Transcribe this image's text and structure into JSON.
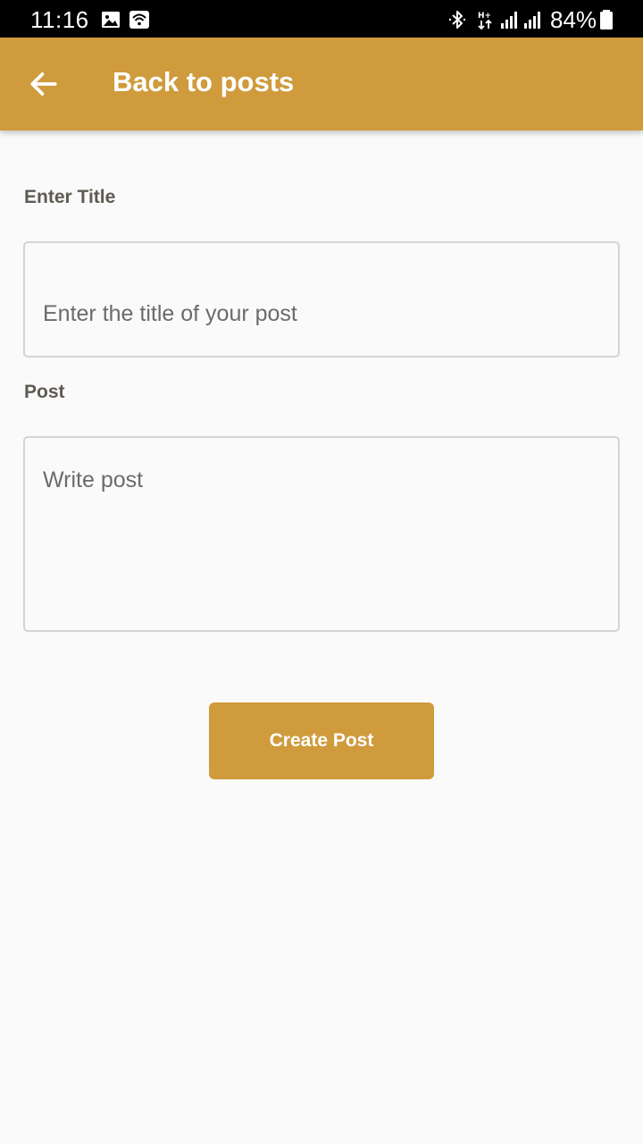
{
  "status_bar": {
    "time": "11:16",
    "battery": "84%",
    "icons": [
      "image-icon",
      "wifi-icon",
      "bluetooth-icon",
      "hplus-data-icon",
      "signal-icon",
      "signal-icon-2",
      "battery-icon"
    ]
  },
  "app_bar": {
    "back_icon": "arrow-back-icon",
    "title": "Back to posts",
    "color": "#cf9b3c"
  },
  "form": {
    "title_label": "Enter Title",
    "title_placeholder": "Enter the title of your post",
    "title_value": "",
    "post_label": "Post",
    "post_placeholder": "Write post",
    "post_value": "",
    "submit_label": "Create Post"
  }
}
